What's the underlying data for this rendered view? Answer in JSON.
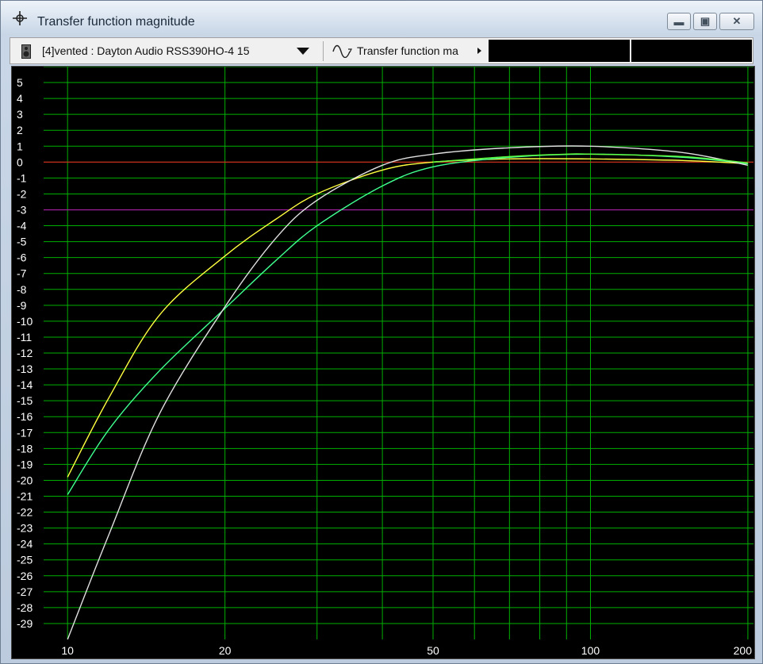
{
  "window": {
    "title": "Transfer function magnitude"
  },
  "icons": {
    "title": "crosshair-icon",
    "dropdown": "speaker-icon",
    "function": "sine-wave-icon"
  },
  "toolbar": {
    "driver_select": "[4]vented : Dayton Audio RSS390HO-4 15",
    "function_select": "Transfer function ma",
    "readout_left": "",
    "readout_right": ""
  },
  "colors": {
    "background": "#000000",
    "grid": "#00b000",
    "reference": "#ff2020",
    "minus3db": "#b000b0"
  },
  "chart_data": {
    "type": "line",
    "x_scale": "log",
    "xlim": [
      9,
      205
    ],
    "ylim": [
      -30,
      6
    ],
    "grid": true,
    "x_tick_labels": [
      {
        "value": 10,
        "label": "10"
      },
      {
        "value": 20,
        "label": "20"
      },
      {
        "value": 50,
        "label": "50"
      },
      {
        "value": 100,
        "label": "100"
      },
      {
        "value": 200,
        "label": "200"
      }
    ],
    "x_gridlines": [
      10,
      20,
      30,
      40,
      50,
      60,
      70,
      80,
      90,
      100,
      200
    ],
    "y_ticks": [
      5,
      4,
      3,
      2,
      1,
      0,
      -1,
      -2,
      -3,
      -4,
      -5,
      -6,
      -7,
      -8,
      -9,
      -10,
      -11,
      -12,
      -13,
      -14,
      -15,
      -16,
      -17,
      -18,
      -19,
      -20,
      -21,
      -22,
      -23,
      -24,
      -25,
      -26,
      -27,
      -28,
      -29
    ],
    "reference_lines": [
      {
        "y": 0,
        "color": "#e02020"
      },
      {
        "y": -3,
        "color": "#a020a0"
      }
    ],
    "series": [
      {
        "color": "#ffff40",
        "x": [
          10,
          12,
          15,
          20,
          25,
          30,
          40,
          50,
          70,
          100,
          150,
          200
        ],
        "y": [
          -19.8,
          -14.8,
          -9.6,
          -5.9,
          -3.6,
          -2.0,
          -0.5,
          0.0,
          0.2,
          0.2,
          0.1,
          -0.1
        ]
      },
      {
        "color": "#40ff90",
        "x": [
          10,
          12,
          15,
          20,
          25,
          30,
          40,
          50,
          70,
          100,
          150,
          200
        ],
        "y": [
          -20.9,
          -16.8,
          -13.1,
          -9.2,
          -6.2,
          -4.0,
          -1.5,
          -0.3,
          0.3,
          0.5,
          0.3,
          -0.1
        ]
      },
      {
        "color": "#e0e0e0",
        "x": [
          10,
          12,
          15,
          20,
          25,
          30,
          40,
          50,
          70,
          100,
          150,
          200
        ],
        "y": [
          -30.0,
          -23.4,
          -15.8,
          -9.1,
          -4.8,
          -2.4,
          -0.2,
          0.5,
          0.9,
          1.0,
          0.6,
          -0.2
        ]
      },
      {
        "color": "#60ff40",
        "x": [
          50,
          70,
          90,
          100,
          150,
          200
        ],
        "y": [
          0.0,
          0.35,
          0.5,
          0.5,
          0.35,
          -0.05
        ]
      }
    ]
  }
}
